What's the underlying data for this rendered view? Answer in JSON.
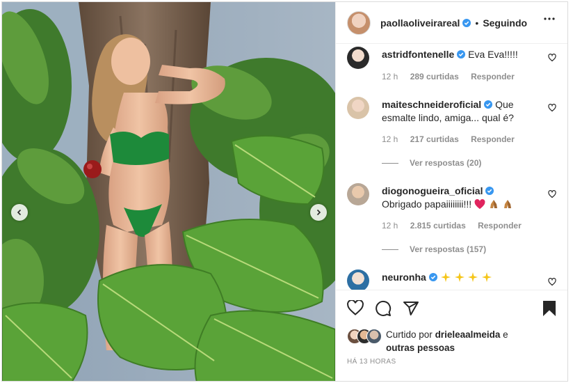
{
  "post": {
    "username": "paollaoliveirareal",
    "follow_status": "Seguindo",
    "separator": "•"
  },
  "comments": [
    {
      "username": "astridfontenelle",
      "text": "Eva Eva!!!!!",
      "time": "12 h",
      "likes": "289 curtidas",
      "reply": "Responder"
    },
    {
      "username": "maiteschneideroficial",
      "text": "Que esmalte lindo, amiga... qual é?",
      "time": "12 h",
      "likes": "217 curtidas",
      "reply": "Responder",
      "view_replies": "Ver respostas (20)"
    },
    {
      "username": "diogonogueira_oficial",
      "text": "Obrigado papaiiiiiiii!!!",
      "time": "12 h",
      "likes": "2.815 curtidas",
      "reply": "Responder",
      "view_replies": "Ver respostas (157)"
    },
    {
      "username": "neuronha",
      "text": ""
    }
  ],
  "liked_by": {
    "prefix": "Curtido por",
    "user": "drieleaalmeida",
    "conj": "e",
    "others": "outras pessoas"
  },
  "timestamp": "HÁ 13 HORAS",
  "icons": {
    "verified": "verified-badge-icon",
    "heart": "heart-icon",
    "comment": "comment-icon",
    "share": "share-icon",
    "save": "bookmark-icon",
    "more": "more-options-icon"
  },
  "colors": {
    "accent_verified": "#3897f0",
    "text": "#262626",
    "muted": "#8e8e8e",
    "heart_red": "#e0245e"
  }
}
